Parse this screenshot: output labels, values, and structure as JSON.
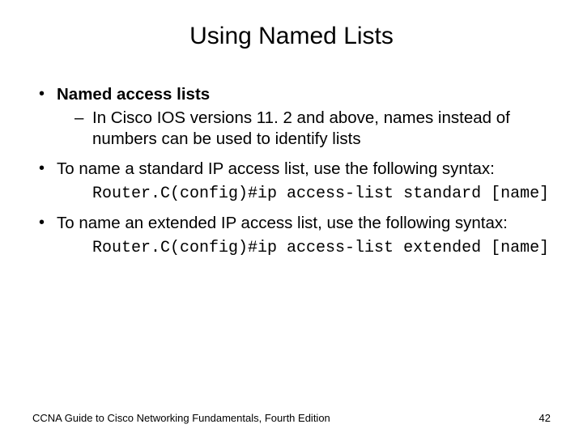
{
  "title": "Using Named Lists",
  "bullets": {
    "b1": {
      "text": "Named access lists"
    },
    "b1_sub1": "In Cisco IOS versions 11. 2 and above, names instead of numbers can be used to identify lists",
    "b2": "To name a standard IP access list, use the following syntax:",
    "b2_code_a": "Router.C(config)#ip access-list standard ",
    "b2_code_b": "[name]",
    "b3": "To name an extended IP access list, use the following syntax:",
    "b3_code_a": "Router.C(config)#ip access-list extended ",
    "b3_code_b": "[name]"
  },
  "footer": {
    "left": "CCNA Guide to Cisco Networking Fundamentals, Fourth Edition",
    "right": "42"
  }
}
